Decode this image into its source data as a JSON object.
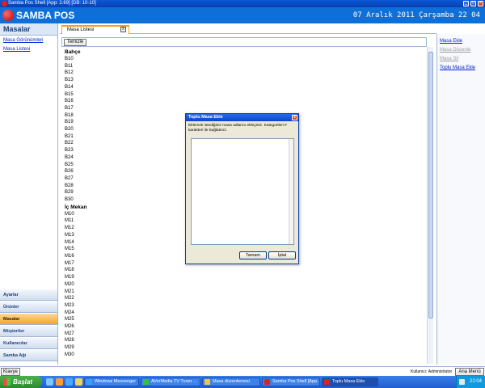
{
  "window": {
    "title": "Samba Pos Shell [App: 2.69] [DB: 10-10]"
  },
  "header": {
    "brand": "SAMBA POS",
    "datetime": "07 Aralık 2011 Çarşamba 22 04"
  },
  "left_panel": {
    "title": "Masalar",
    "links": [
      "Masa Görünümleri",
      "Masa Listesi"
    ],
    "nav": [
      {
        "label": "Ayarlar",
        "active": false
      },
      {
        "label": "Ürünler",
        "active": false
      },
      {
        "label": "Masalar",
        "active": true
      },
      {
        "label": "Müşteriler",
        "active": false
      },
      {
        "label": "Kullanıcılar",
        "active": false
      },
      {
        "label": "Samba Ağı",
        "active": false
      }
    ]
  },
  "center": {
    "tab_label": "Masa Listesi",
    "tab_close": "x",
    "clear_button": "Temizle",
    "categories": [
      {
        "name": "Bahçe",
        "tables": [
          "B10",
          "B11",
          "B12",
          "B13",
          "B14",
          "B15",
          "B16",
          "B17",
          "B18",
          "B19",
          "B20",
          "B21",
          "B22",
          "B23",
          "B24",
          "B25",
          "B26",
          "B27",
          "B28",
          "B29",
          "B30"
        ]
      },
      {
        "name": "İç Mekan",
        "tables": [
          "M10",
          "M11",
          "M12",
          "M13",
          "M14",
          "M15",
          "M16",
          "M17",
          "M18",
          "M19",
          "M20",
          "M21",
          "M22",
          "M23",
          "M24",
          "M25",
          "M26",
          "M27",
          "M28",
          "M29",
          "M30"
        ]
      }
    ]
  },
  "right_panel": {
    "actions": [
      {
        "label": "Masa Ekle",
        "enabled": true
      },
      {
        "label": "Masa Düzenle",
        "enabled": false
      },
      {
        "label": "Masa Sil",
        "enabled": false
      },
      {
        "label": "Toplu Masa Ekle",
        "enabled": true
      }
    ]
  },
  "statusbar": {
    "keyboard_button": "Klavye",
    "user_label": "Kullanıcı:",
    "user_name": "Administrator",
    "main_menu_button": "Ana Menü"
  },
  "dialog": {
    "title": "Toplu Masa Ekle",
    "close": "x",
    "message": "Eklemek istediğiniz masa adlarını ekleyiniz. Kategorileri # karakteri ile bağlatınız.",
    "text_value": "",
    "ok_button": "Tamam",
    "cancel_button": "İptal"
  },
  "taskbar": {
    "start_label": "Başlat",
    "tasks": [
      {
        "label": "Windows Messenger",
        "icon_color": "#3aa0ff",
        "active": false
      },
      {
        "label": "AVerMedia TV Tuner ...",
        "icon_color": "#35c035",
        "active": false
      },
      {
        "label": "Masa düzenlemesi",
        "icon_color": "#f5c542",
        "active": false
      },
      {
        "label": "Samba Pos Shell [App...",
        "icon_color": "#e02020",
        "active": false
      },
      {
        "label": "Toplu Masa Ekle",
        "icon_color": "#e02020",
        "active": true
      }
    ],
    "clock": "22:04"
  },
  "colors": {
    "header_blue": "#0f6fd8",
    "active_nav": "#f5a623",
    "link_blue": "#0020c8"
  }
}
